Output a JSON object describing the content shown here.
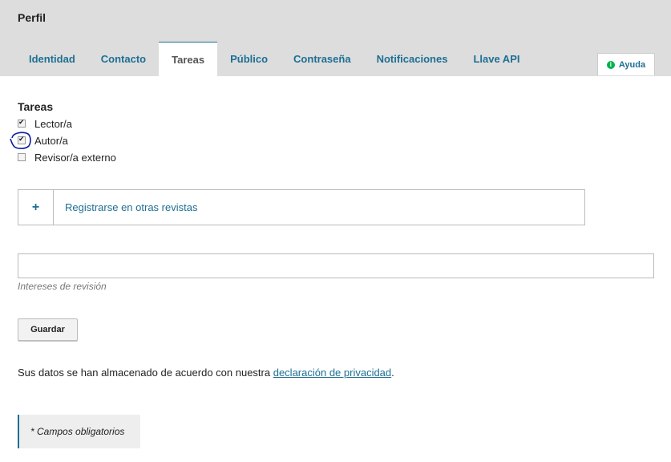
{
  "page": {
    "title": "Perfil"
  },
  "tabs": [
    {
      "label": "Identidad",
      "active": false
    },
    {
      "label": "Contacto",
      "active": false
    },
    {
      "label": "Tareas",
      "active": true
    },
    {
      "label": "Público",
      "active": false
    },
    {
      "label": "Contraseña",
      "active": false
    },
    {
      "label": "Notificaciones",
      "active": false
    },
    {
      "label": "Llave API",
      "active": false
    }
  ],
  "help": {
    "icon": "info-icon",
    "label": "Ayuda"
  },
  "roles": {
    "heading": "Tareas",
    "items": [
      {
        "label": "Lector/a",
        "checked": true
      },
      {
        "label": "Autor/a",
        "checked": true
      },
      {
        "label": "Revisor/a externo",
        "checked": false
      }
    ]
  },
  "register": {
    "icon": "+",
    "label": "Registrarse en otras revistas"
  },
  "interests": {
    "value": "",
    "label": "Intereses de revisión"
  },
  "save": {
    "label": "Guardar"
  },
  "privacy": {
    "prefix": "Sus datos se han almacenado de acuerdo con nuestra ",
    "link": "declaración de privacidad",
    "suffix": "."
  },
  "required_note": "* Campos obligatorios",
  "colors": {
    "accent": "#1d6f93",
    "header_bg": "#dddddd",
    "annotation": "#0a1aa8",
    "help_icon": "#00b24e"
  }
}
